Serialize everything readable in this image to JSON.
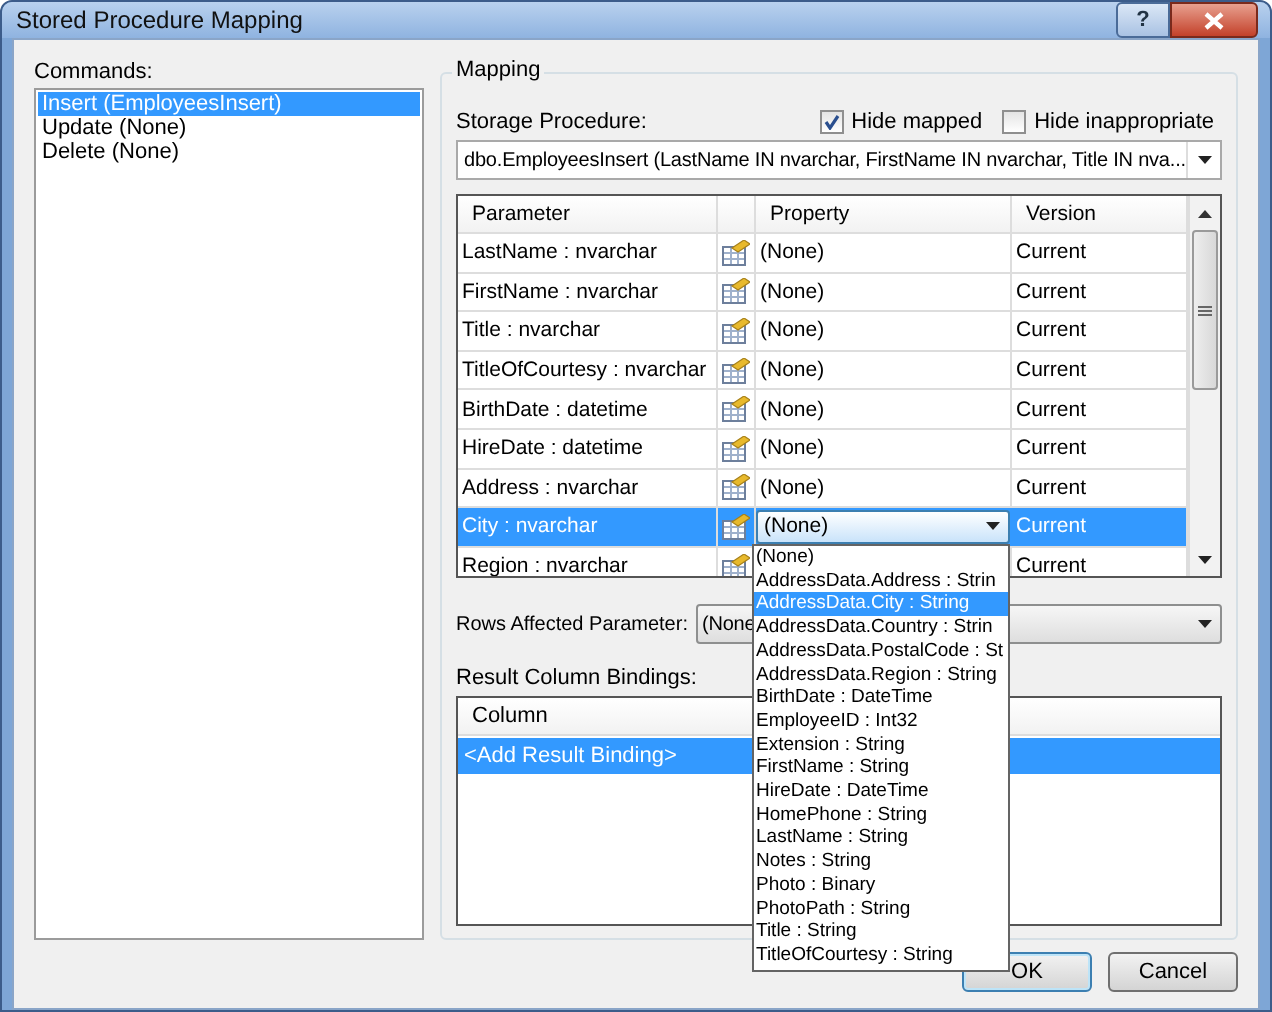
{
  "window": {
    "title": "Stored Procedure Mapping",
    "help_button": "?"
  },
  "commands": {
    "label": "Commands:",
    "items": [
      {
        "label": "Insert (EmployeesInsert)",
        "selected": true
      },
      {
        "label": "Update (None)",
        "selected": false
      },
      {
        "label": "Delete (None)",
        "selected": false
      }
    ]
  },
  "mapping": {
    "title": "Mapping",
    "storage_procedure_label": "Storage Procedure:",
    "hide_mapped": {
      "label": "Hide mapped",
      "checked": true
    },
    "hide_inappropriate": {
      "label": "Hide inappropriate",
      "checked": false
    },
    "storage_procedure_value": "dbo.EmployeesInsert (LastName IN nvarchar, FirstName IN nvarchar, Title IN nva...",
    "grid": {
      "columns": [
        "Parameter",
        "Property",
        "Version"
      ],
      "rows": [
        {
          "parameter": "LastName : nvarchar",
          "property": "(None)",
          "version": "Current",
          "selected": false
        },
        {
          "parameter": "FirstName : nvarchar",
          "property": "(None)",
          "version": "Current",
          "selected": false
        },
        {
          "parameter": "Title : nvarchar",
          "property": "(None)",
          "version": "Current",
          "selected": false
        },
        {
          "parameter": "TitleOfCourtesy : nvarchar",
          "property": "(None)",
          "version": "Current",
          "selected": false
        },
        {
          "parameter": "BirthDate : datetime",
          "property": "(None)",
          "version": "Current",
          "selected": false
        },
        {
          "parameter": "HireDate : datetime",
          "property": "(None)",
          "version": "Current",
          "selected": false
        },
        {
          "parameter": "Address : nvarchar",
          "property": "(None)",
          "version": "Current",
          "selected": false
        },
        {
          "parameter": "City : nvarchar",
          "property": "(None)",
          "version": "Current",
          "selected": true
        },
        {
          "parameter": "Region : nvarchar",
          "version": "Current",
          "selected": false
        }
      ]
    },
    "property_dropdown": [
      {
        "label": "(None)",
        "selected": false
      },
      {
        "label": "AddressData.Address : Strin",
        "selected": false
      },
      {
        "label": "AddressData.City : String",
        "selected": true
      },
      {
        "label": "AddressData.Country : Strin",
        "selected": false
      },
      {
        "label": "AddressData.PostalCode : St",
        "selected": false
      },
      {
        "label": "AddressData.Region : String",
        "selected": false
      },
      {
        "label": "BirthDate : DateTime",
        "selected": false
      },
      {
        "label": "EmployeeID : Int32",
        "selected": false
      },
      {
        "label": "Extension : String",
        "selected": false
      },
      {
        "label": "FirstName : String",
        "selected": false
      },
      {
        "label": "HireDate : DateTime",
        "selected": false
      },
      {
        "label": "HomePhone : String",
        "selected": false
      },
      {
        "label": "LastName : String",
        "selected": false
      },
      {
        "label": "Notes : String",
        "selected": false
      },
      {
        "label": "Photo : Binary",
        "selected": false
      },
      {
        "label": "PhotoPath : String",
        "selected": false
      },
      {
        "label": "Title : String",
        "selected": false
      },
      {
        "label": "TitleOfCourtesy : String",
        "selected": false
      }
    ],
    "rows_affected_label": "Rows Affected Parameter:",
    "rows_affected_value": "(None",
    "result_bindings_label": "Result Column Bindings:",
    "result_bindings": {
      "columns": [
        "Column"
      ],
      "rows": [
        {
          "label": "<Add Result Binding>",
          "selected": true
        }
      ]
    }
  },
  "buttons": [
    "OK",
    "Cancel"
  ]
}
